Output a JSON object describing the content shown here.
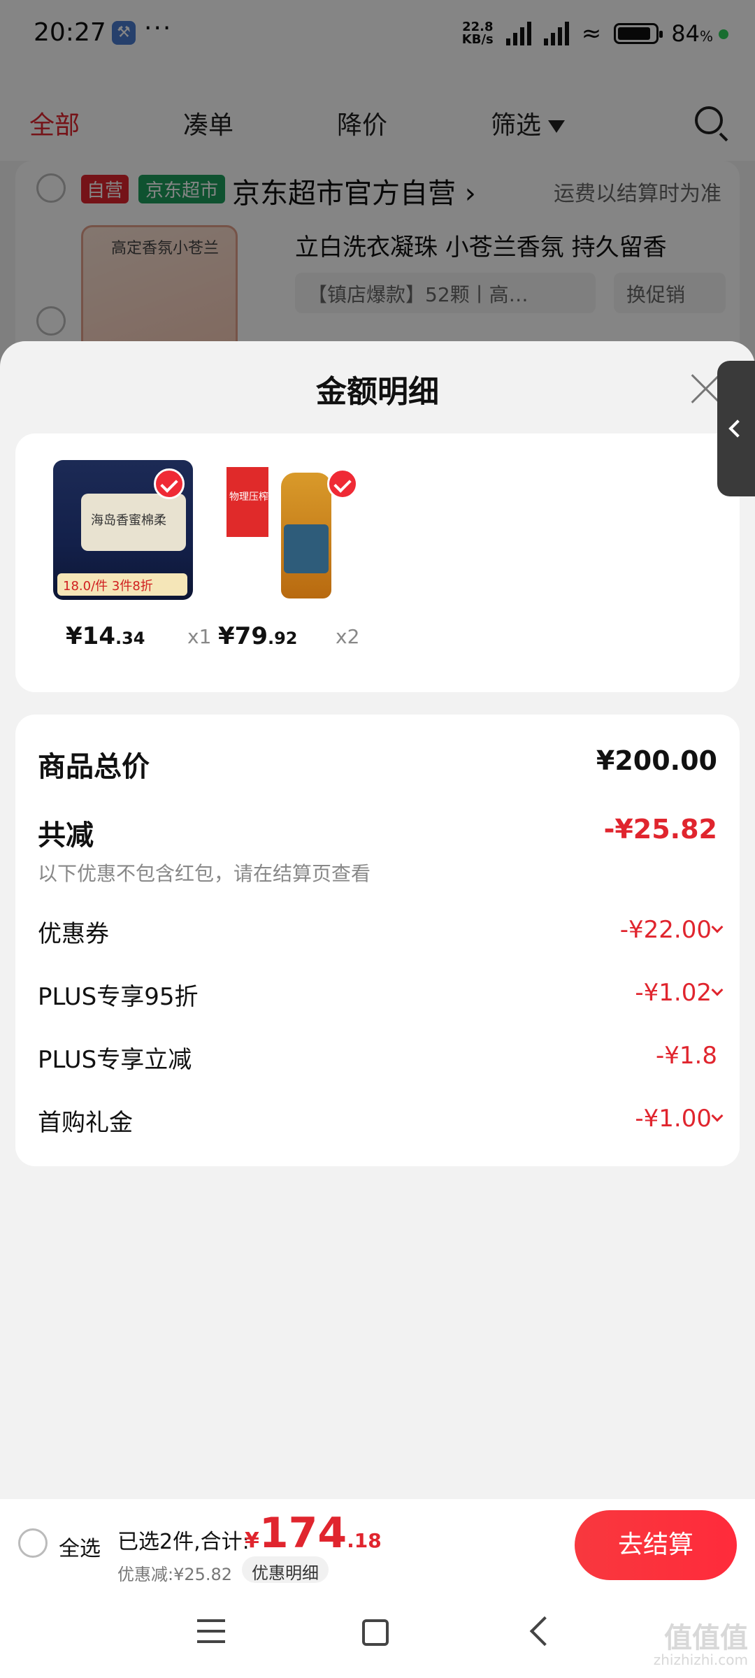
{
  "status_bar": {
    "time": "20:27",
    "net_speed_value": "22.8",
    "net_speed_unit": "KB/s",
    "battery": "84"
  },
  "tabs": [
    {
      "label": "全部",
      "active": true
    },
    {
      "label": "凑单",
      "active": false
    },
    {
      "label": "降价",
      "active": false
    },
    {
      "label": "筛选",
      "active": false
    }
  ],
  "shop": {
    "tag_self": "自营",
    "tag_market": "京东超市",
    "name": "京东超市官方自营",
    "shipping_note": "运费以结算时为准",
    "product_title": "立白洗衣凝珠 小苍兰香氛 持久留香",
    "product_thumb_text": "高定香氛小苍兰",
    "spec": "【镇店爆款】52颗丨高…",
    "promo": "换促销"
  },
  "sheet": {
    "title": "金额明细",
    "items": [
      {
        "price_int": "¥14",
        "price_dec": ".34",
        "qty": "x1",
        "image_text": "海岛香蜜棉柔",
        "banner": "18.0/件  3件8折",
        "icon": "sanitary-pad-product-image"
      },
      {
        "price_int": "¥79",
        "price_dec": ".92",
        "qty": "x2",
        "image_text": "物理压榨",
        "icon": "peanut-oil-product-image"
      }
    ],
    "summary": {
      "total_label": "商品总价",
      "total_value": "¥200.00",
      "reduce_label": "共减",
      "reduce_value": "-¥25.82",
      "note": "以下优惠不包含红包，请在结算页查看",
      "rows": [
        {
          "label": "优惠券",
          "value": "-¥22.00",
          "expandable": true
        },
        {
          "label": "PLUS专享95折",
          "value": "-¥1.02",
          "expandable": true
        },
        {
          "label": "PLUS专享立减",
          "value": "-¥1.8",
          "expandable": false
        },
        {
          "label": "首购礼金",
          "value": "-¥1.00",
          "expandable": true
        }
      ]
    }
  },
  "checkout": {
    "select_all": "全选",
    "selected_text": "已选2件,合计:",
    "currency": "¥",
    "total_int": "174",
    "total_dec": ".18",
    "discount_text": "优惠减:¥25.82",
    "detail_button": "优惠明细",
    "checkout_button": "去结算"
  },
  "watermark": {
    "main": "值值值",
    "sub": "zhizhizhi.com"
  },
  "colors": {
    "accent": "#e0252e",
    "green_tag": "#1e9e5c"
  }
}
